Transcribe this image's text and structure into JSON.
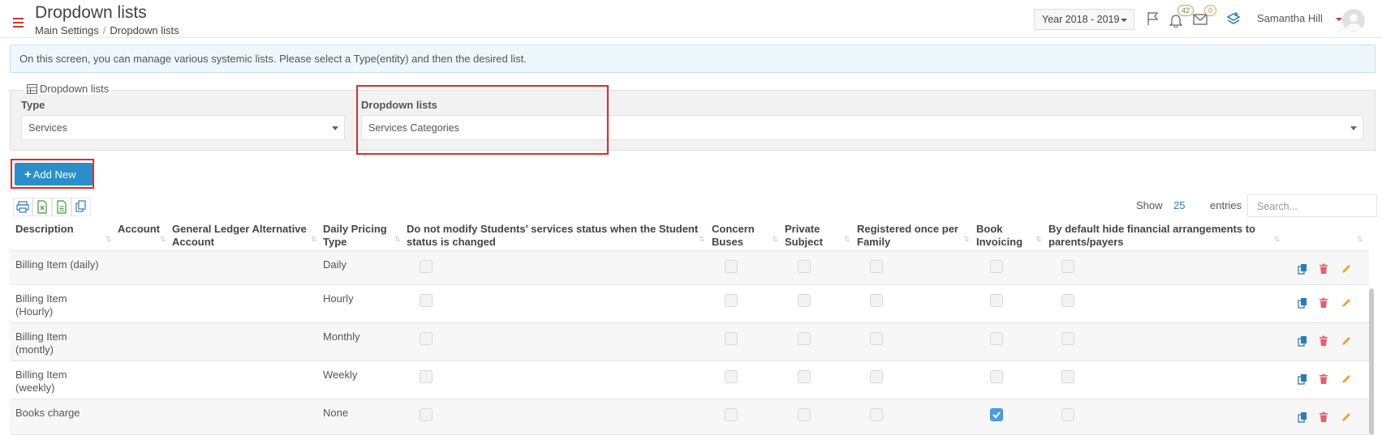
{
  "header": {
    "title": "Dropdown lists",
    "breadcrumb": [
      "Main Settings",
      "/",
      "Dropdown lists"
    ],
    "year_select": "Year 2018 - 2019",
    "notifications_count": "42",
    "messages_count": "0",
    "user_name": "Samantha Hill"
  },
  "info": {
    "text": "On this screen, you can manage various systemic lists. Please select a Type(entity) and then the desired list."
  },
  "filter": {
    "legend": "Dropdown lists",
    "type_label": "Type",
    "type_value": "Services",
    "list_label": "Dropdown lists",
    "list_value": "Services Categories"
  },
  "toolbar": {
    "add_label": "Add New",
    "show_label": "Show",
    "show_value": "25",
    "entries_label": "entries",
    "search_placeholder": "Search..."
  },
  "table": {
    "headers": {
      "description": "Description",
      "account": "Account",
      "gl_line1": "General Ledger Alternative",
      "gl_line2": "Account",
      "pricing_line1": "Daily Pricing",
      "pricing_line2": "Type",
      "nomodify_line1": "Do not modify Students' services status when the Student",
      "nomodify_line2": "status is changed",
      "buses_line1": "Concern",
      "buses_line2": "Buses",
      "private_line1": "Private",
      "private_line2": "Subject",
      "registered_line1": "Registered once per",
      "registered_line2": "Family",
      "book_line1": "Book",
      "book_line2": "Invoicing",
      "hide_line1": "By default hide financial arrangements to",
      "hide_line2": "parents/payers"
    },
    "rows": [
      {
        "desc1": "Billing Item (daily)",
        "desc2": "",
        "pricing": "Daily",
        "book": false
      },
      {
        "desc1": "Billing Item",
        "desc2": "(Hourly)",
        "pricing": "Hourly",
        "book": false
      },
      {
        "desc1": "Billing Item",
        "desc2": "(montly)",
        "pricing": "Monthly",
        "book": false
      },
      {
        "desc1": "Billing Item",
        "desc2": "(weekly)",
        "pricing": "Weekly",
        "book": false
      },
      {
        "desc1": "Books charge",
        "desc2": "",
        "pricing": "None",
        "book": true
      }
    ]
  },
  "colors": {
    "accent": "#2b8ec8",
    "highlight_box": "#d32f2f",
    "delete": "#e85c6a",
    "edit": "#f0a030",
    "copy": "#2b7bb9"
  }
}
